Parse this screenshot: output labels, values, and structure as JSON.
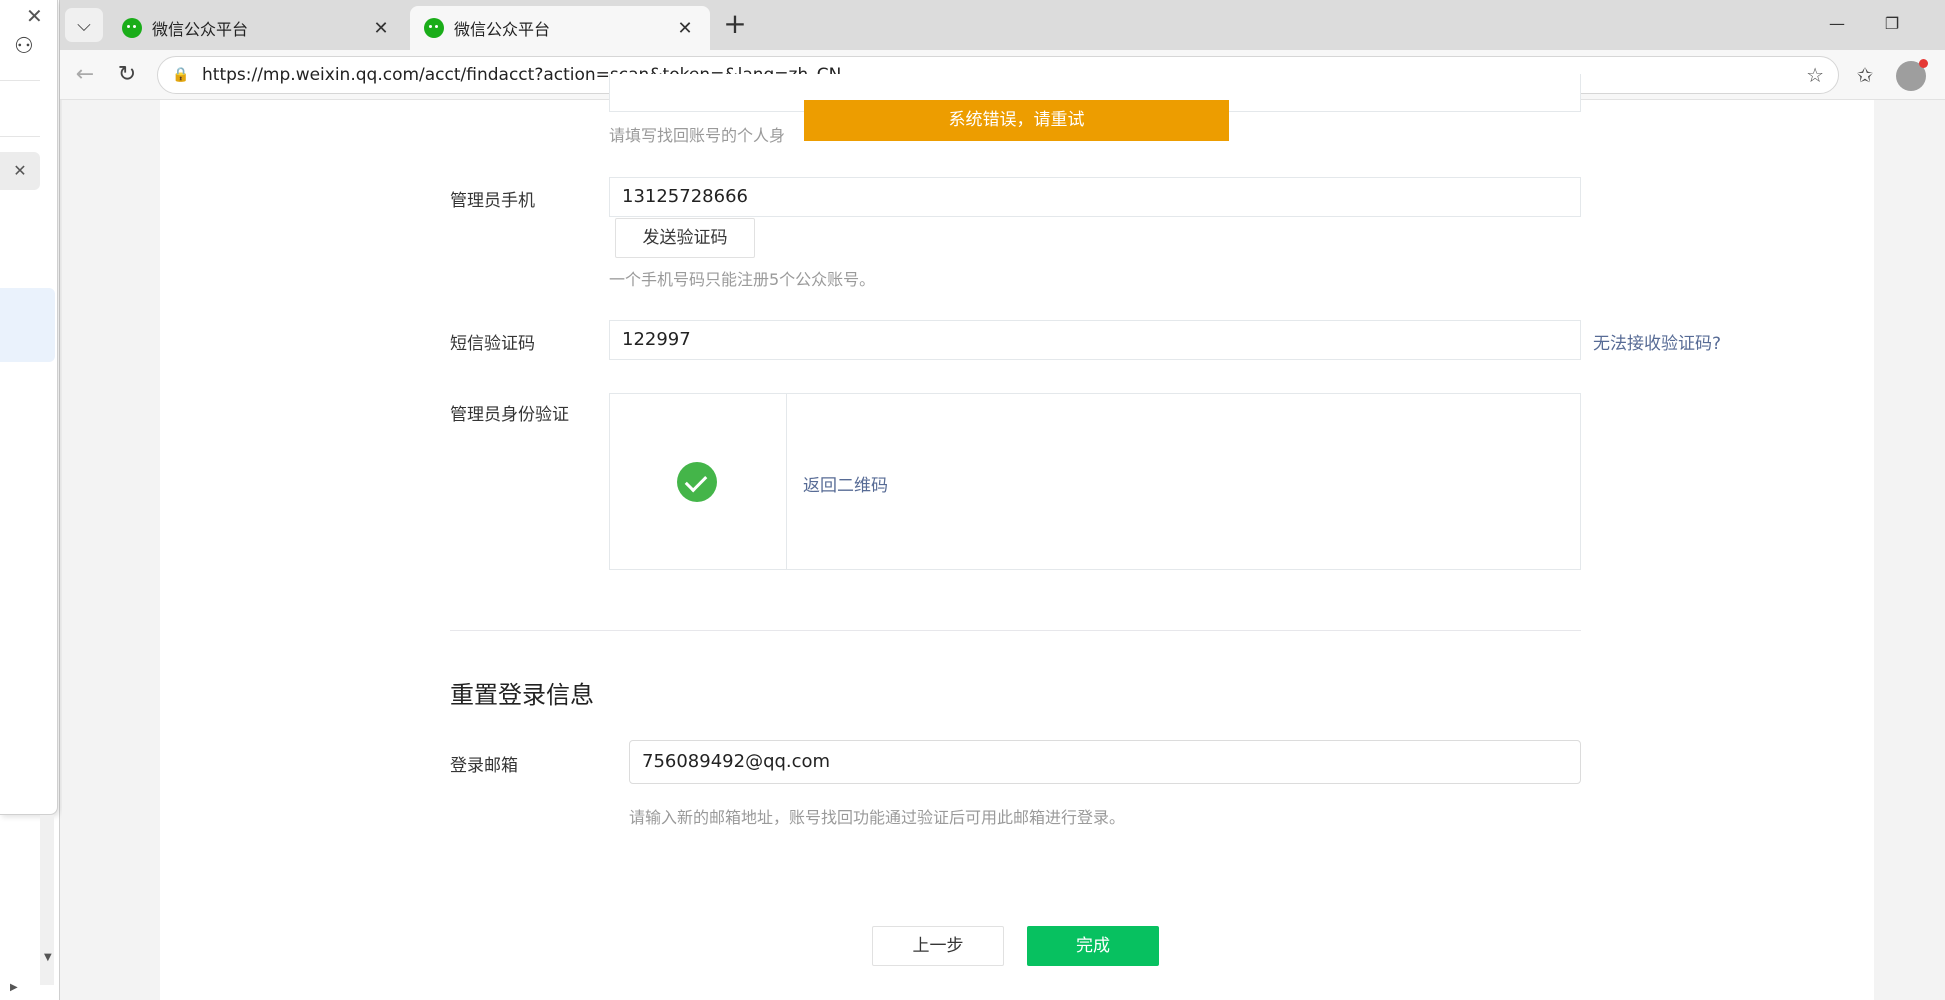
{
  "browser": {
    "tabs": [
      {
        "title": "微信公众平台",
        "active": false
      },
      {
        "title": "微信公众平台",
        "active": true
      }
    ],
    "address": "https://mp.weixin.qq.com/acct/findacct?action=scan&token=&lang=zh_CN"
  },
  "form": {
    "top_field_hint": "请填写找回账号的个人身",
    "toast": "系统错误，请重试",
    "phone_label": "管理员手机",
    "phone_value": "13125728666",
    "send_code_label": "发送验证码",
    "phone_hint": "一个手机号码只能注册5个公众账号。",
    "sms_label": "短信验证码",
    "sms_value": "122997",
    "sms_help_link": "无法接收验证码?",
    "identity_label": "管理员身份验证",
    "back_qr_link": "返回二维码"
  },
  "reset": {
    "title": "重置登录信息",
    "email_label": "登录邮箱",
    "email_value": "756089492@qq.com",
    "email_hint": "请输入新的邮箱地址，账号找回功能通过验证后可用此邮箱进行登录。"
  },
  "actions": {
    "prev_label": "上一步",
    "done_label": "完成"
  },
  "colors": {
    "toast_bg": "#ed9d00",
    "primary_button": "#07c160",
    "link": "#576b95",
    "success": "#44b549"
  }
}
